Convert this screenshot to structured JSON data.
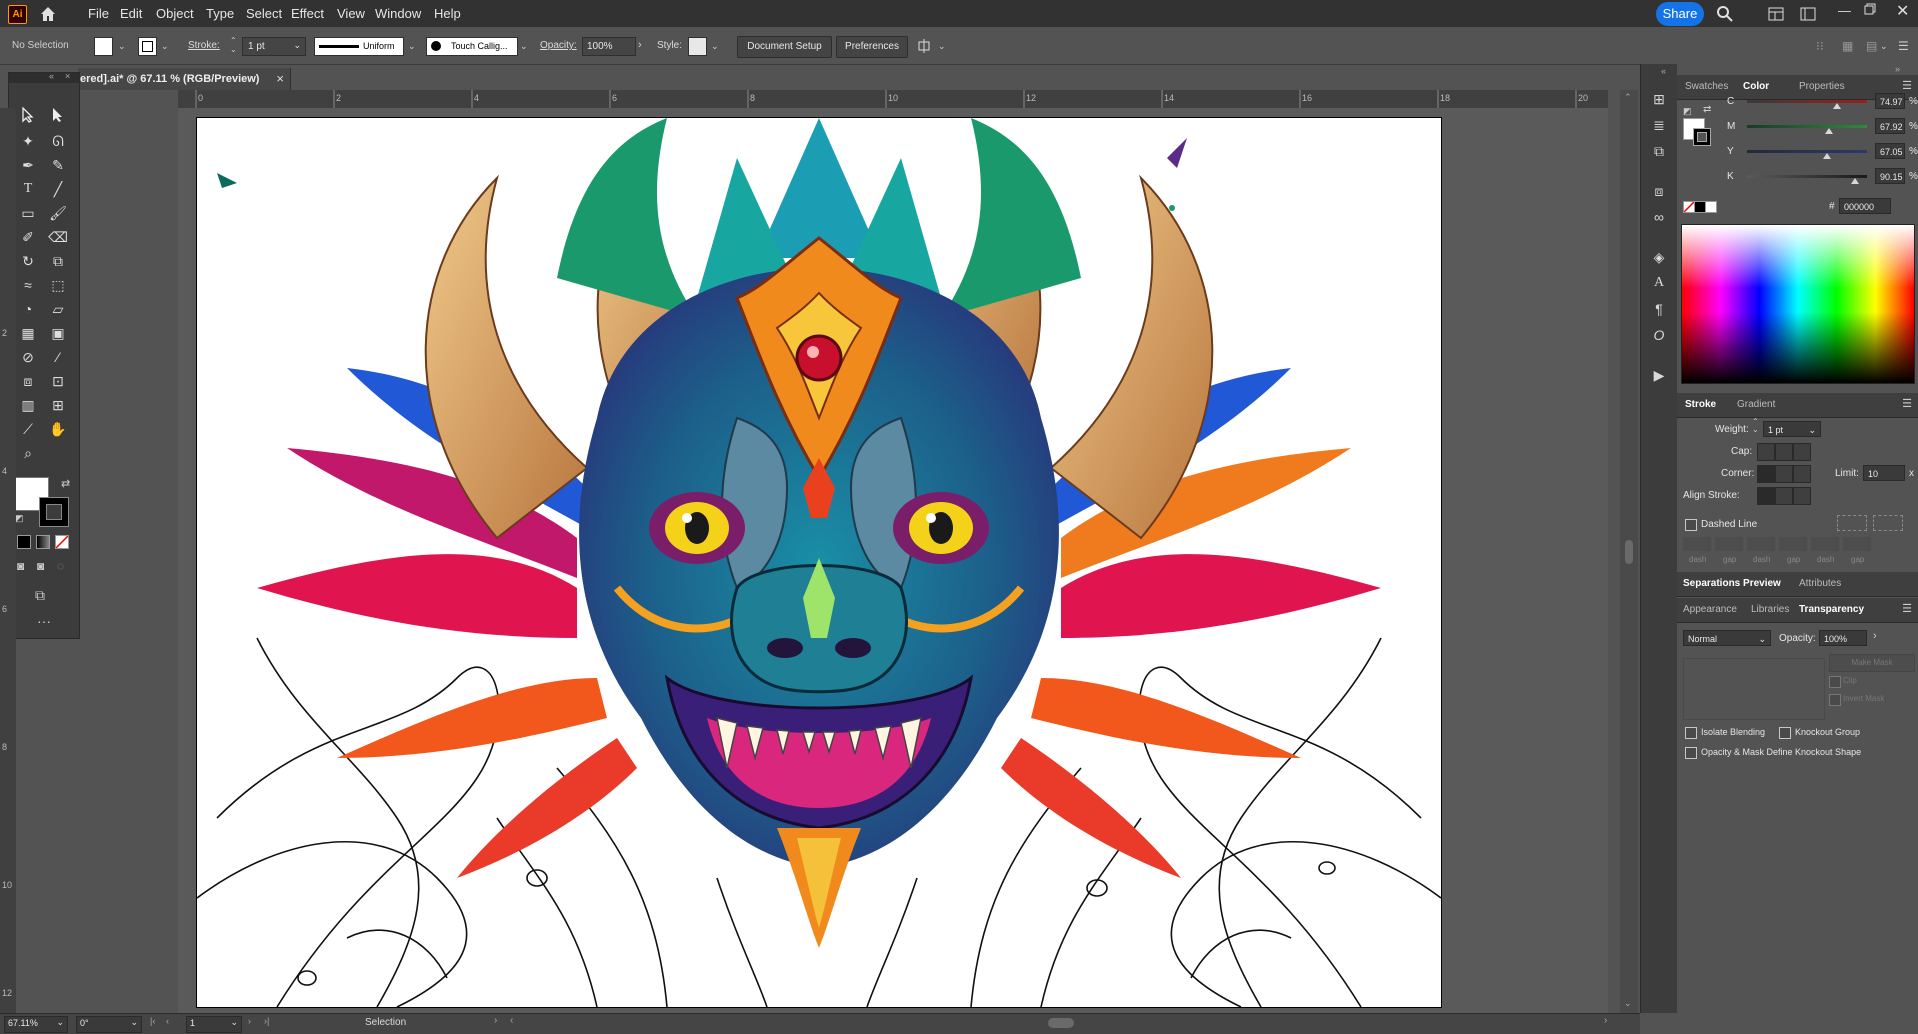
{
  "app": {
    "logo": "Ai"
  },
  "menu": [
    "File",
    "Edit",
    "Object",
    "Type",
    "Select",
    "Effect",
    "View",
    "Window",
    "Help"
  ],
  "share_label": "Share",
  "control": {
    "selection": "No Selection",
    "stroke_label": "Stroke:",
    "stroke_weight": "1 pt",
    "profile": "Uniform",
    "brush": "Touch Callig...",
    "opacity_label": "Opacity:",
    "opacity": "100%",
    "style_label": "Style:",
    "doc_setup": "Document Setup",
    "preferences": "Preferences"
  },
  "document_tab": {
    "title": "ered].ai* @ 67.11 % (RGB/Preview)",
    "close": "×"
  },
  "ruler": {
    "h_labels": [
      "0",
      "2",
      "4",
      "6",
      "8",
      "10",
      "12",
      "14",
      "16",
      "18",
      "20"
    ],
    "v_labels": [
      "2",
      "4",
      "6",
      "8",
      "10",
      "12"
    ]
  },
  "status": {
    "zoom": "67.11%",
    "rotation": "0°",
    "artboard": "1",
    "tool": "Selection"
  },
  "color_panel": {
    "tabs": [
      "Swatches",
      "Color",
      "Properties"
    ],
    "active_tab": "Color",
    "channels": [
      {
        "name": "C",
        "value": "74.97",
        "fraction": 0.75
      },
      {
        "name": "M",
        "value": "67.92",
        "fraction": 0.68
      },
      {
        "name": "Y",
        "value": "67.05",
        "fraction": 0.67
      },
      {
        "name": "K",
        "value": "90.15",
        "fraction": 0.9
      }
    ],
    "percent": "%",
    "hash": "#",
    "hex": "000000"
  },
  "stroke_panel": {
    "tabs": [
      "Stroke",
      "Gradient"
    ],
    "weight_label": "Weight:",
    "weight": "1 pt",
    "cap_label": "Cap:",
    "corner_label": "Corner:",
    "limit_label": "Limit:",
    "limit": "10",
    "limit_x": "x",
    "align_label": "Align Stroke:",
    "dashed_label": "Dashed Line",
    "dash_labels": [
      "dash",
      "gap",
      "dash",
      "gap",
      "dash",
      "gap"
    ]
  },
  "sep_panel": {
    "tabs": [
      "Separations Preview",
      "Attributes"
    ]
  },
  "transparency_panel": {
    "tabs": [
      "Appearance",
      "Libraries",
      "Transparency"
    ],
    "blend": "Normal",
    "opacity_label": "Opacity:",
    "opacity": "100%",
    "make_mask": "Make Mask",
    "clip": "Clip",
    "invert": "Invert Mask",
    "isolate": "Isolate Blending",
    "knockout": "Knockout Group",
    "define": "Opacity & Mask Define Knockout Shape"
  },
  "colors": {
    "accent": "#1473e6",
    "ui_dark": "#323232",
    "ui_mid": "#535353"
  }
}
